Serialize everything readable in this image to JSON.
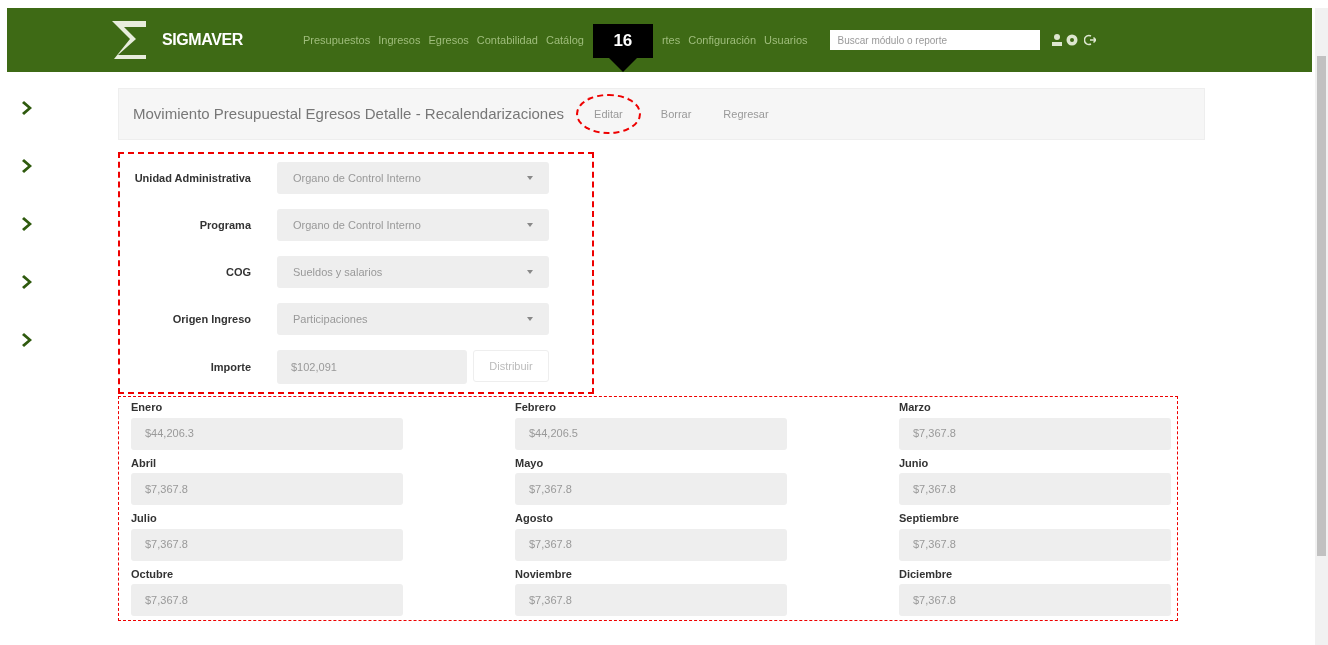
{
  "header": {
    "brand": "SIGMAVER",
    "nav": [
      "Presupuestos",
      "Ingresos",
      "Egresos",
      "Contabilidad",
      "Catálog",
      "rtes",
      "Configuración",
      "Usuarios"
    ],
    "search": {
      "placeholder": "Buscar módulo o reporte"
    }
  },
  "callout": {
    "number": "16"
  },
  "sidebar": {
    "items": [
      {
        "kind": "chevron"
      },
      {
        "kind": "chevron"
      },
      {
        "kind": "chevron"
      },
      {
        "kind": "chevron"
      },
      {
        "kind": "chevron"
      }
    ]
  },
  "page": {
    "title": "Movimiento Presupuestal Egresos Detalle - Recalendarizaciones",
    "actions": [
      {
        "label": "Editar",
        "highlighted": true
      },
      {
        "label": "Borrar",
        "highlighted": false
      },
      {
        "label": "Regresar",
        "highlighted": false
      }
    ]
  },
  "form": {
    "fields": [
      {
        "label": "Unidad Administrativa",
        "kind": "select",
        "value": "Organo de Control Interno"
      },
      {
        "label": "Programa",
        "kind": "select",
        "value": "Organo de Control Interno"
      },
      {
        "label": "COG",
        "kind": "select",
        "value": "Sueldos y salarios"
      },
      {
        "label": "Origen Ingreso",
        "kind": "select",
        "value": "Participaciones"
      },
      {
        "label": "Importe",
        "kind": "input",
        "value": "$102,091",
        "button": "Distribuir"
      }
    ]
  },
  "months": [
    {
      "label": "Enero",
      "value": "$44,206.3"
    },
    {
      "label": "Febrero",
      "value": "$44,206.5"
    },
    {
      "label": "Marzo",
      "value": "$7,367.8"
    },
    {
      "label": "Abril",
      "value": "$7,367.8"
    },
    {
      "label": "Mayo",
      "value": "$7,367.8"
    },
    {
      "label": "Junio",
      "value": "$7,367.8"
    },
    {
      "label": "Julio",
      "value": "$7,367.8"
    },
    {
      "label": "Agosto",
      "value": "$7,367.8"
    },
    {
      "label": "Septiembre",
      "value": "$7,367.8"
    },
    {
      "label": "Octubre",
      "value": "$7,367.8"
    },
    {
      "label": "Noviembre",
      "value": "$7,367.8"
    },
    {
      "label": "Diciembre",
      "value": "$7,367.8"
    }
  ]
}
